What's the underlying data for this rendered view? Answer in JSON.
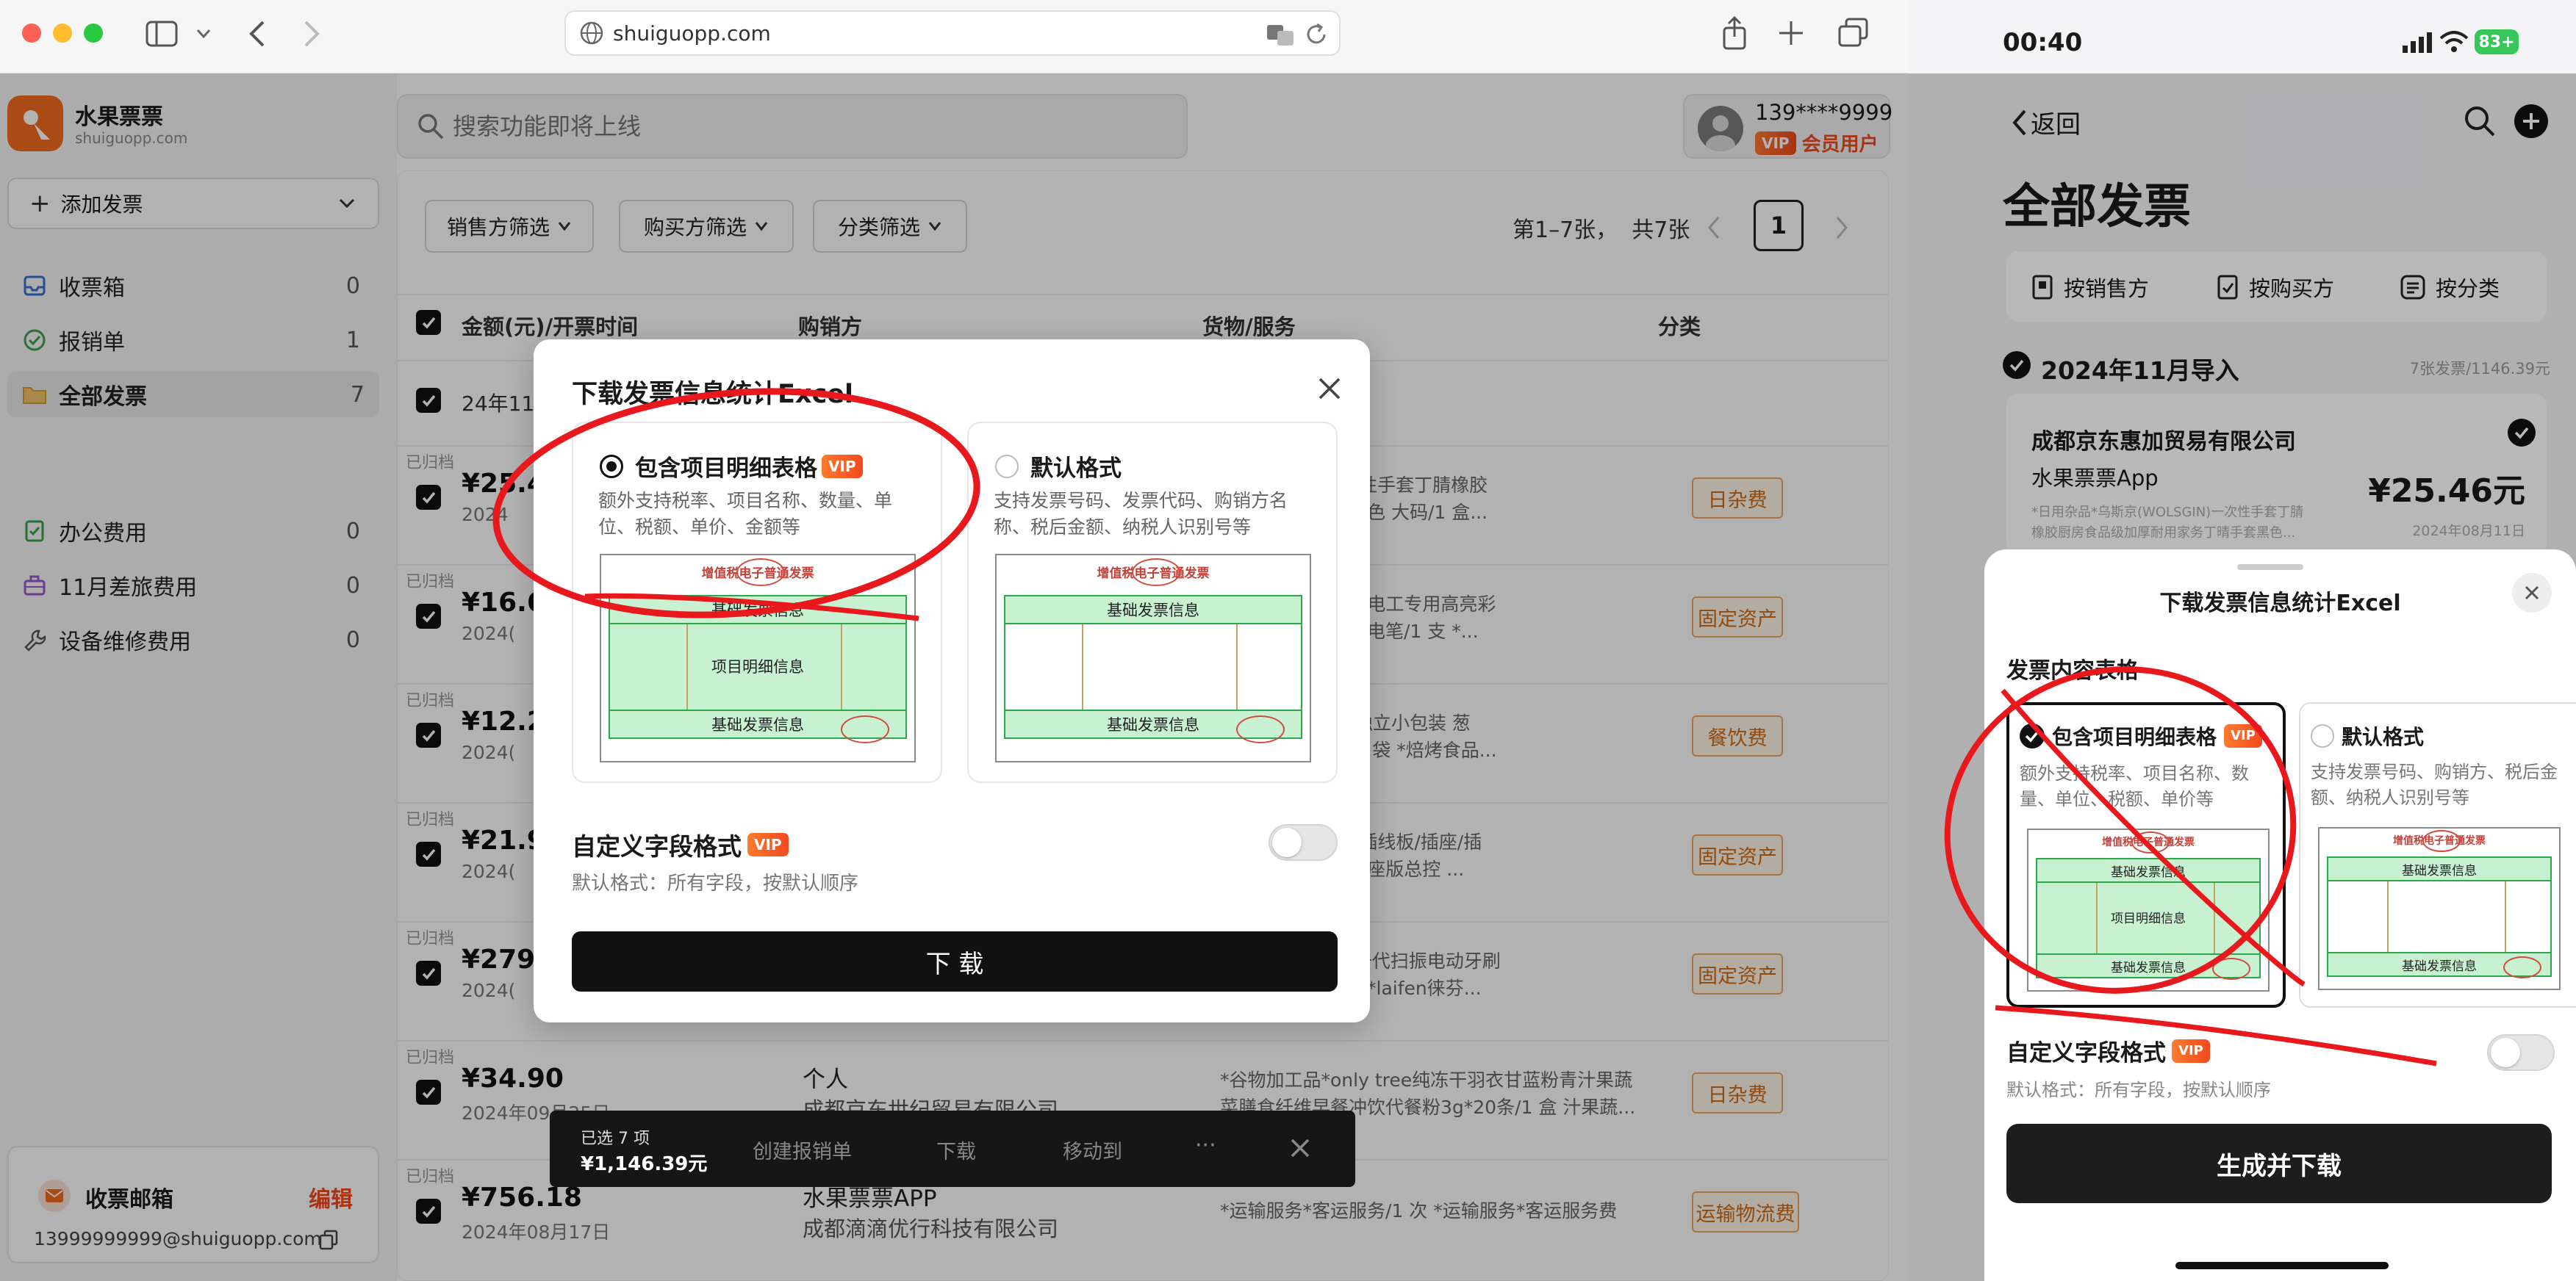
{
  "browser": {
    "url": "shuiguopp.com"
  },
  "app": {
    "name": "水果票票",
    "domain": "shuiguopp.com"
  },
  "search": {
    "placeholder": "搜索功能即将上线"
  },
  "user": {
    "phone": "139****9999",
    "member": "会员用户",
    "vip": "VIP"
  },
  "sidebar": {
    "add_label": "添加发票",
    "items": [
      {
        "label": "收票箱",
        "count": "0",
        "icon": "inbox-icon"
      },
      {
        "label": "报销单",
        "count": "1",
        "icon": "check-circle-icon"
      },
      {
        "label": "全部发票",
        "count": "7",
        "icon": "folder-icon"
      },
      {
        "label": "办公费用",
        "count": "0",
        "icon": "doc-icon"
      },
      {
        "label": "11月差旅费用",
        "count": "0",
        "icon": "briefcase-icon"
      },
      {
        "label": "设备维修费用",
        "count": "0",
        "icon": "wrench-icon"
      }
    ],
    "mail_title": "收票邮箱",
    "mail_edit": "编辑",
    "mail_address": "13999999999@shuiguopp.com"
  },
  "filters": {
    "seller": "销售方筛选",
    "buyer": "购买方筛选",
    "category": "分类筛选",
    "pager_text": "第1–7张，  共7张",
    "page": "1"
  },
  "table": {
    "headers": {
      "amount": "金额(元)/开票时间",
      "party": "购销方",
      "goods": "货物/服务",
      "category": "分类"
    },
    "group_label": "24年11月",
    "archived_label": "已归档",
    "rows": [
      {
        "amount": "¥25.4",
        "date": "2024",
        "goods1": "(WOLSGIN)一次性手套丁腈橡胶",
        "goods2": "用家务丁晴手套黑色 大码/1 盒...",
        "tag": "日杂费"
      },
      {
        "amount": "¥16.6",
        "date": "2024(",
        "goods1": "力西(DELIXI)电笔电工专用高亮彩",
        "goods2": "能感应通断验电试电笔/1 支 *...",
        "tag": "固定资产"
      },
      {
        "amount": "¥12.2",
        "date": "2024(",
        "goods1": "休闲零食 小麻花独立小包装 葱",
        "goods2": "产零食糕点小吃/1 袋 *焙烤食品...",
        "tag": "餐饮费"
      },
      {
        "amount": "¥21.9",
        "date": "2024(",
        "goods1": "米(MI)米家5孔位插线板/插座/插",
        "goods2": "板/接线板/插板/插座版总控 ...",
        "tag": "固定资产"
      },
      {
        "amount": "¥279.",
        "date": "2024(",
        "goods1": "器*laifen徕芬新一代扫振电动牙刷",
        "goods2": "家用美容保健电器*laifen徕芬...",
        "tag": "固定资产"
      },
      {
        "amount": "¥34.90",
        "date": "2024年09月25日",
        "buyer": "个人",
        "seller": "成都京东世纪贸易有限公司",
        "goods1": "*谷物加工品*only tree纯冻干羽衣甘蓝粉青汁果蔬",
        "goods2": "菜膳食纤维早餐冲饮代餐粉3g*20条/1 盒 汁果蔬...",
        "tag": "日杂费"
      },
      {
        "amount": "¥756.18",
        "date": "2024年08月17日",
        "buyer": "水果票票APP",
        "seller": "成都滴滴优行科技有限公司",
        "goods1": "*运输服务*客运服务/1 次 *运输服务*客运服务费",
        "goods2": "",
        "tag": "运输物流费"
      }
    ]
  },
  "bottom_bar": {
    "selected": "已选 7 项",
    "total": "¥1,146.39元",
    "create": "创建报销单",
    "download": "下载",
    "move": "移动到",
    "more": "···"
  },
  "modal": {
    "title": "下载发票信息统计Excel",
    "opt1_title": "包含项目明细表格",
    "opt1_desc": "额外支持税率、项目名称、数量、单位、税额、单价、金额等",
    "opt2_title": "默认格式",
    "opt2_desc": "支持发票号码、发票代码、购销方名称、税后金额、纳税人识别号等",
    "preview_title": "增值税电子普通发票",
    "band_basic": "基础发票信息",
    "band_detail": "项目明细信息",
    "custom_title": "自定义字段格式",
    "custom_desc": "默认格式：所有字段，按默认顺序",
    "download_btn": "下 载"
  },
  "phone": {
    "time": "00:40",
    "battery": "83+",
    "back": "返回",
    "page_title": "全部发票",
    "tabs": [
      "按销售方",
      "按购买方",
      "按分类"
    ],
    "group_title": "2024年11月导入",
    "group_meta": "7张发票/1146.39元",
    "card_company": "成都京东惠加贸易有限公司",
    "card_app": "水果票票App",
    "card_amount": "¥25.46元",
    "card_goods1": "*日用杂品*乌斯京(WOLSGIN)一次性手套丁腈",
    "card_goods2": "橡胶厨房食品级加厚耐用家务丁晴手套黑色...",
    "card_date": "2024年08月11日",
    "sheet_title": "下载发票信息统计Excel",
    "section": "发票内容表格",
    "opt1_title": "包含项目明细表格",
    "opt1_desc": "额外支持税率、项目名称、数量、单位、税额、单价等",
    "opt2_title": "默认格式",
    "opt2_desc": "支持发票号码、购销方、税后金额、纳税人识别号等",
    "custom_title": "自定义字段格式",
    "custom_desc": "默认格式：所有字段，按默认顺序",
    "generate_btn": "生成并下载"
  }
}
